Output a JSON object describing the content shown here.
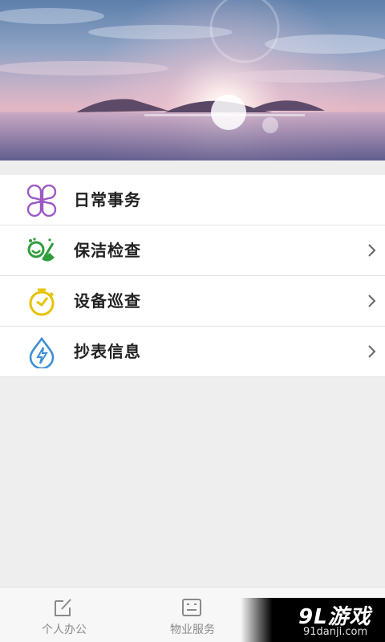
{
  "banner": {
    "image": "sunset-lake-scene"
  },
  "menu": {
    "items": [
      {
        "label": "日常事务",
        "icon": "clover-grid-icon",
        "icon_color": "#9b59c6",
        "has_chevron": false
      },
      {
        "label": "保洁检查",
        "icon": "broom-icon",
        "icon_color": "#2e9d3a",
        "has_chevron": true
      },
      {
        "label": "设备巡查",
        "icon": "timer-icon",
        "icon_color": "#e6c300",
        "has_chevron": true
      },
      {
        "label": "抄表信息",
        "icon": "water-drop-lightning-icon",
        "icon_color": "#3d8fd6",
        "has_chevron": true
      }
    ]
  },
  "tabbar": {
    "tabs": [
      {
        "label": "个人办公",
        "icon": "edit-icon"
      },
      {
        "label": "物业服务",
        "icon": "id-card-icon"
      }
    ]
  },
  "watermark": {
    "brand": "9L游戏",
    "url": "91danji.com"
  }
}
